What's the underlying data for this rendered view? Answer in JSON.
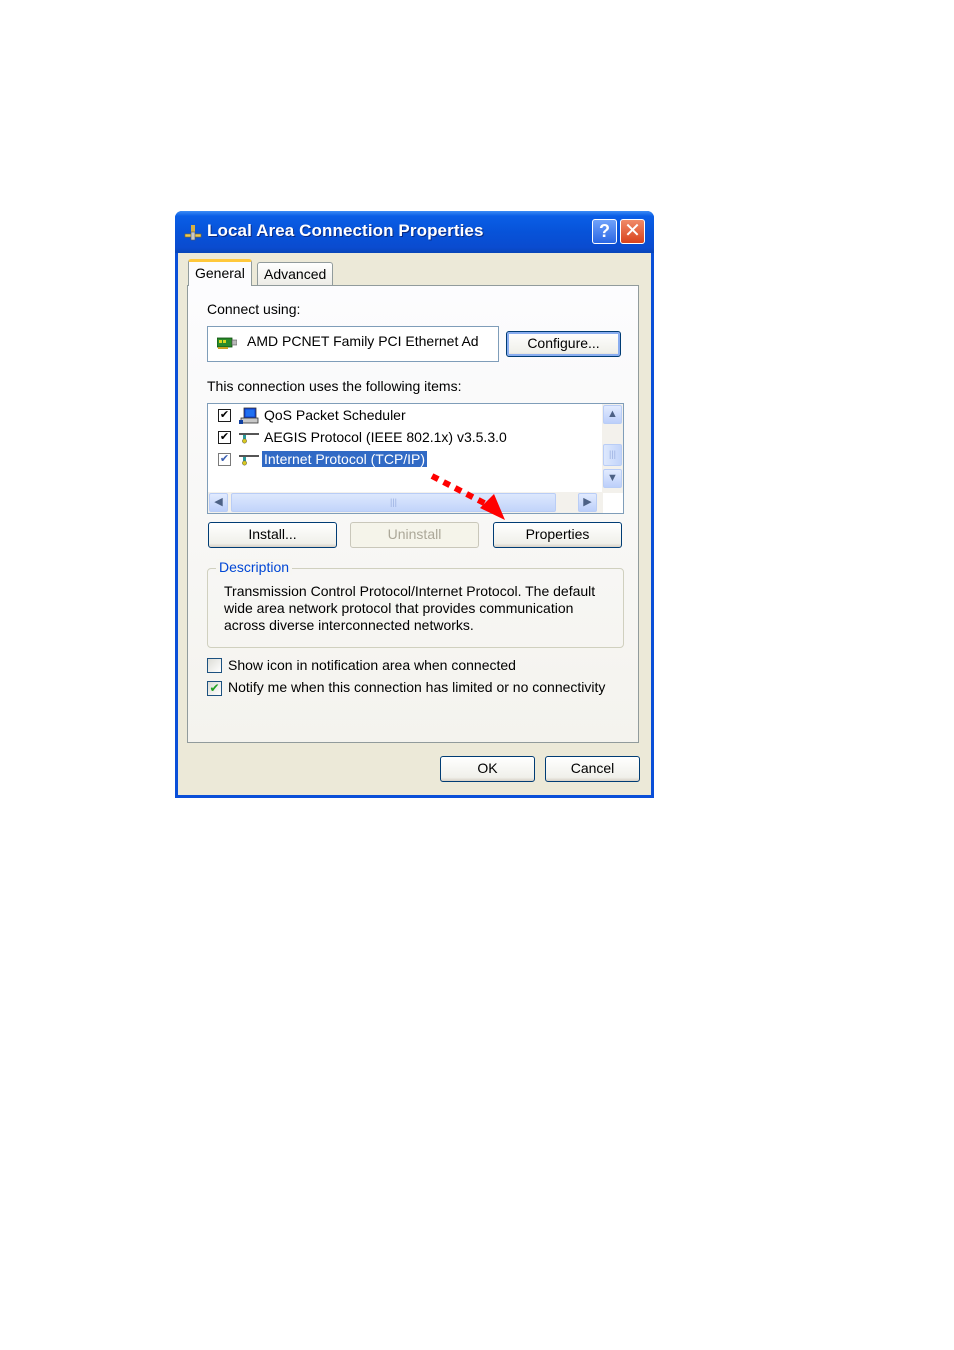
{
  "window": {
    "title": "Local Area Connection Properties",
    "title_icon": "network-connection-icon",
    "help_button": "?",
    "close_button": "✕"
  },
  "tabs": [
    {
      "label": "General",
      "active": true
    },
    {
      "label": "Advanced",
      "active": false
    }
  ],
  "general": {
    "connect_using_label": "Connect using:",
    "adapter_name": "AMD PCNET Family PCI Ethernet Ad",
    "adapter_icon": "network-adapter-icon",
    "configure_button": "Configure...",
    "items_label": "This connection uses the following items:",
    "items": [
      {
        "label": "QoS Packet Scheduler",
        "checked": true,
        "icon": "computer-icon",
        "selected": false
      },
      {
        "label": "AEGIS Protocol (IEEE 802.1x) v3.5.3.0",
        "checked": true,
        "icon": "protocol-icon",
        "selected": false
      },
      {
        "label": "Internet Protocol (TCP/IP)",
        "checked": true,
        "icon": "protocol-icon",
        "selected": true
      }
    ],
    "install_button": "Install...",
    "uninstall_button": "Uninstall",
    "properties_button": "Properties",
    "description_title": "Description",
    "description_text": "Transmission Control Protocol/Internet Protocol. The default wide area network protocol that provides communication across diverse interconnected networks.",
    "show_icon_checkbox": {
      "label": "Show icon in notification area when connected",
      "checked": false
    },
    "notify_checkbox": {
      "label": "Notify me when this connection has limited or no connectivity",
      "checked": true
    }
  },
  "footer": {
    "ok_button": "OK",
    "cancel_button": "Cancel"
  },
  "annotation": {
    "arrow_color": "#ff0000",
    "from": "Internet Protocol (TCP/IP)",
    "to": "Properties"
  },
  "scrollbar": {
    "up": "▲",
    "down": "▼",
    "left": "◀",
    "right": "▶",
    "grip": "|||"
  }
}
